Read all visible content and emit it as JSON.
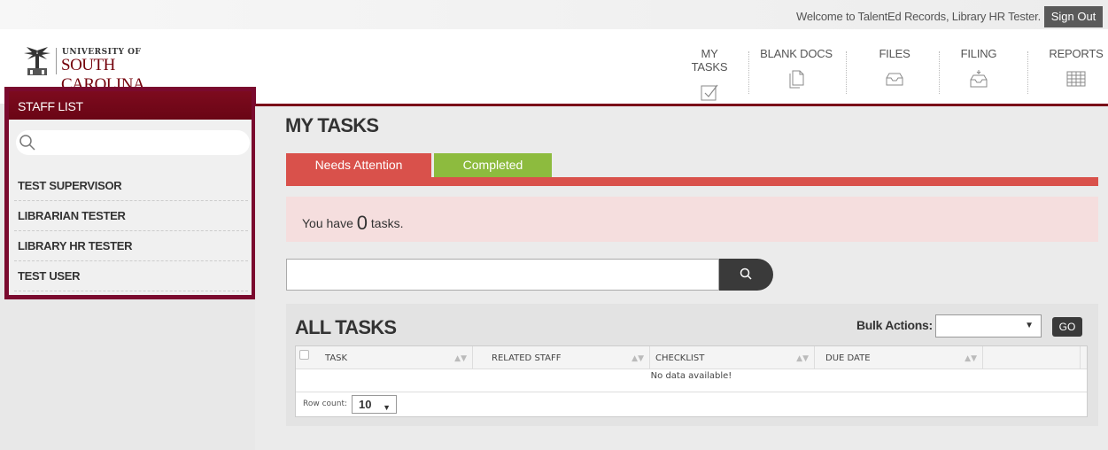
{
  "topbar": {
    "welcome": "Welcome to TalentEd Records, Library HR Tester.",
    "sign_out": "Sign Out"
  },
  "logo": {
    "top": "UNIVERSITY OF",
    "bottom": "SOUTH CAROLINA"
  },
  "nav": [
    {
      "label": "MY TASKS",
      "icon": "checkbox-icon"
    },
    {
      "label": "BLANK DOCS",
      "icon": "document-icon"
    },
    {
      "label": "FILES",
      "icon": "inbox-tray-icon"
    },
    {
      "label": "FILING",
      "icon": "filing-tray-icon"
    },
    {
      "label": "REPORTS",
      "icon": "grid-table-icon"
    }
  ],
  "sidebar": {
    "title": "STAFF LIST",
    "search_placeholder": "",
    "items": [
      "TEST SUPERVISOR",
      "LIBRARIAN TESTER",
      "LIBRARY HR TESTER",
      "TEST USER"
    ]
  },
  "main": {
    "title": "MY TASKS",
    "tabs": [
      {
        "label": "Needs Attention",
        "active": true
      },
      {
        "label": "Completed",
        "active": false
      }
    ],
    "notice_prefix": "You have",
    "notice_count": "0",
    "notice_suffix": "tasks.",
    "search_value": ""
  },
  "tasks": {
    "title": "ALL TASKS",
    "bulk_label": "Bulk Actions:",
    "bulk_value": "",
    "go": "GO",
    "columns": [
      "TASK",
      "RELATED STAFF",
      "CHECKLIST",
      "DUE DATE"
    ],
    "empty": "No data available!",
    "rowcount_label": "Row count:",
    "rowcount_value": "10"
  },
  "colors": {
    "garnet": "#73000a",
    "needs_attention": "#d9514b",
    "completed": "#8dbb3e"
  }
}
